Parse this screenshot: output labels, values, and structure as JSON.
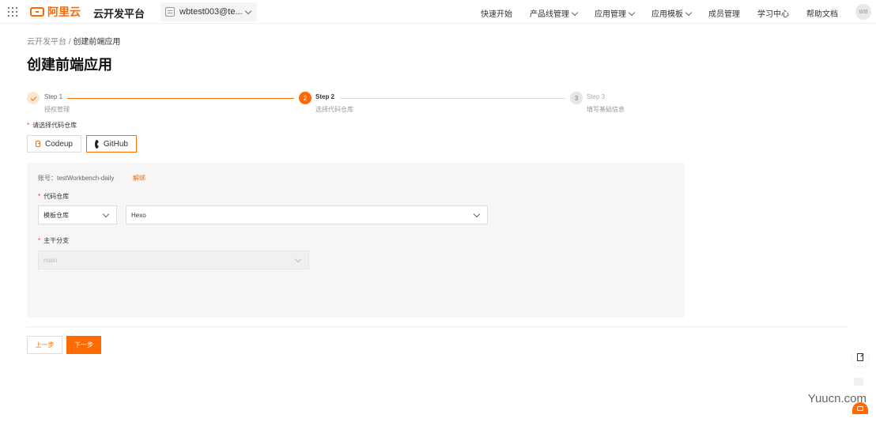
{
  "colors": {
    "accent": "#ff6a00",
    "panel_bg": "#f6f6f6",
    "completed_step_bg": "#fde6d2",
    "inactive_step": "#dddddd"
  },
  "header": {
    "brand": "阿里云",
    "product": "云开发平台",
    "account": "wbtest003@te...",
    "nav_items": [
      "快速开始",
      "产品线管理",
      "应用管理",
      "应用模板",
      "成员管理",
      "学习中心",
      "帮助文档"
    ],
    "avatar": "WB"
  },
  "breadcrumb": {
    "parent": "云开发平台",
    "separator": "/",
    "current": "创建前端应用"
  },
  "page_title": "创建前端应用",
  "steps": [
    {
      "title": "Step 1",
      "desc": "授权管理",
      "state": "done",
      "number": "1",
      "icon": "check-icon"
    },
    {
      "title": "Step 2",
      "desc": "选择代码仓库",
      "state": "current",
      "number": "2"
    },
    {
      "title": "Step 3",
      "desc": "填写基础信息",
      "state": "pending",
      "number": "3"
    }
  ],
  "repository": {
    "label": "请选择代码仓库",
    "options": [
      {
        "label": "Codeup",
        "icon": "codeup-icon"
      },
      {
        "label": "GitHub",
        "icon": "github-icon",
        "selected": true
      }
    ]
  },
  "panel": {
    "account_label": "账号：testWorkbench-daily",
    "unbind": "解绑",
    "repo_label": "代码仓库",
    "repo_type": "模板仓库",
    "repo_name": "Hexo",
    "branch_label": "主干分支",
    "branch_value": "main"
  },
  "actions": {
    "prev": "上一步",
    "next": "下一步"
  },
  "watermark": "Yuucn.com"
}
